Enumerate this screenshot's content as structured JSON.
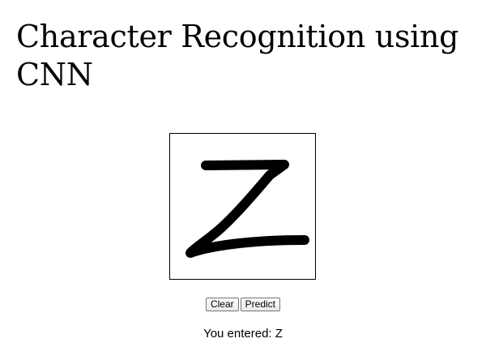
{
  "page": {
    "title": "Character Recognition using CNN"
  },
  "canvas": {
    "drawn_character": "Z",
    "stroke_color": "#000000",
    "background_color": "#ffffff"
  },
  "controls": {
    "clear_label": "Clear",
    "predict_label": "Predict"
  },
  "result": {
    "text": "You entered: Z"
  }
}
